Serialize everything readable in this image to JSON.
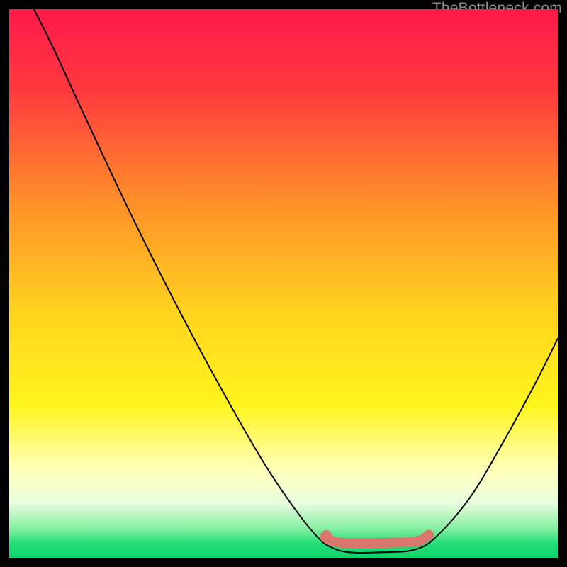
{
  "watermark": "TheBottleneck.com",
  "chart_data": {
    "type": "line",
    "title": "",
    "xlabel": "",
    "ylabel": "",
    "xlim": [
      0,
      100
    ],
    "ylim": [
      0,
      100
    ],
    "background_gradient": {
      "stops": [
        {
          "offset": 0.0,
          "color": "#ff1a4b"
        },
        {
          "offset": 0.15,
          "color": "#ff3a3f"
        },
        {
          "offset": 0.35,
          "color": "#ff8f2a"
        },
        {
          "offset": 0.55,
          "color": "#ffd21f"
        },
        {
          "offset": 0.72,
          "color": "#fff51c"
        },
        {
          "offset": 0.84,
          "color": "#ffffbb"
        },
        {
          "offset": 0.9,
          "color": "#eafde0"
        },
        {
          "offset": 0.945,
          "color": "#8af0a4"
        },
        {
          "offset": 0.975,
          "color": "#22dd77"
        },
        {
          "offset": 1.0,
          "color": "#0fd66a"
        }
      ]
    },
    "series": [
      {
        "name": "bottleneck-curve",
        "type": "curve",
        "color": "#000000",
        "width": 2,
        "points": [
          {
            "x": 4.5,
            "y": 100.0
          },
          {
            "x": 8.0,
            "y": 93.0
          },
          {
            "x": 14.0,
            "y": 80.0
          },
          {
            "x": 22.0,
            "y": 63.0
          },
          {
            "x": 30.0,
            "y": 47.0
          },
          {
            "x": 38.0,
            "y": 32.0
          },
          {
            "x": 46.0,
            "y": 18.0
          },
          {
            "x": 52.0,
            "y": 9.0
          },
          {
            "x": 56.0,
            "y": 4.0
          },
          {
            "x": 58.5,
            "y": 2.0
          },
          {
            "x": 62.0,
            "y": 1.0
          },
          {
            "x": 68.0,
            "y": 1.0
          },
          {
            "x": 74.0,
            "y": 1.5
          },
          {
            "x": 78.0,
            "y": 4.0
          },
          {
            "x": 84.0,
            "y": 11.0
          },
          {
            "x": 90.0,
            "y": 21.0
          },
          {
            "x": 96.0,
            "y": 32.0
          },
          {
            "x": 100.0,
            "y": 40.0
          }
        ]
      },
      {
        "name": "optimal-range-marker",
        "type": "marker-band",
        "color": "#d9776c",
        "width": 14,
        "points": [
          {
            "x": 57.5,
            "y": 3.8
          },
          {
            "x": 58.5,
            "y": 3.2
          },
          {
            "x": 61.0,
            "y": 2.7
          },
          {
            "x": 66.0,
            "y": 2.7
          },
          {
            "x": 71.0,
            "y": 2.8
          },
          {
            "x": 74.5,
            "y": 3.0
          },
          {
            "x": 76.5,
            "y": 4.2
          }
        ]
      },
      {
        "name": "optimal-start-dot",
        "type": "point",
        "color": "#d9776c",
        "radius": 8,
        "x": 57.8,
        "y": 4.0
      }
    ]
  }
}
